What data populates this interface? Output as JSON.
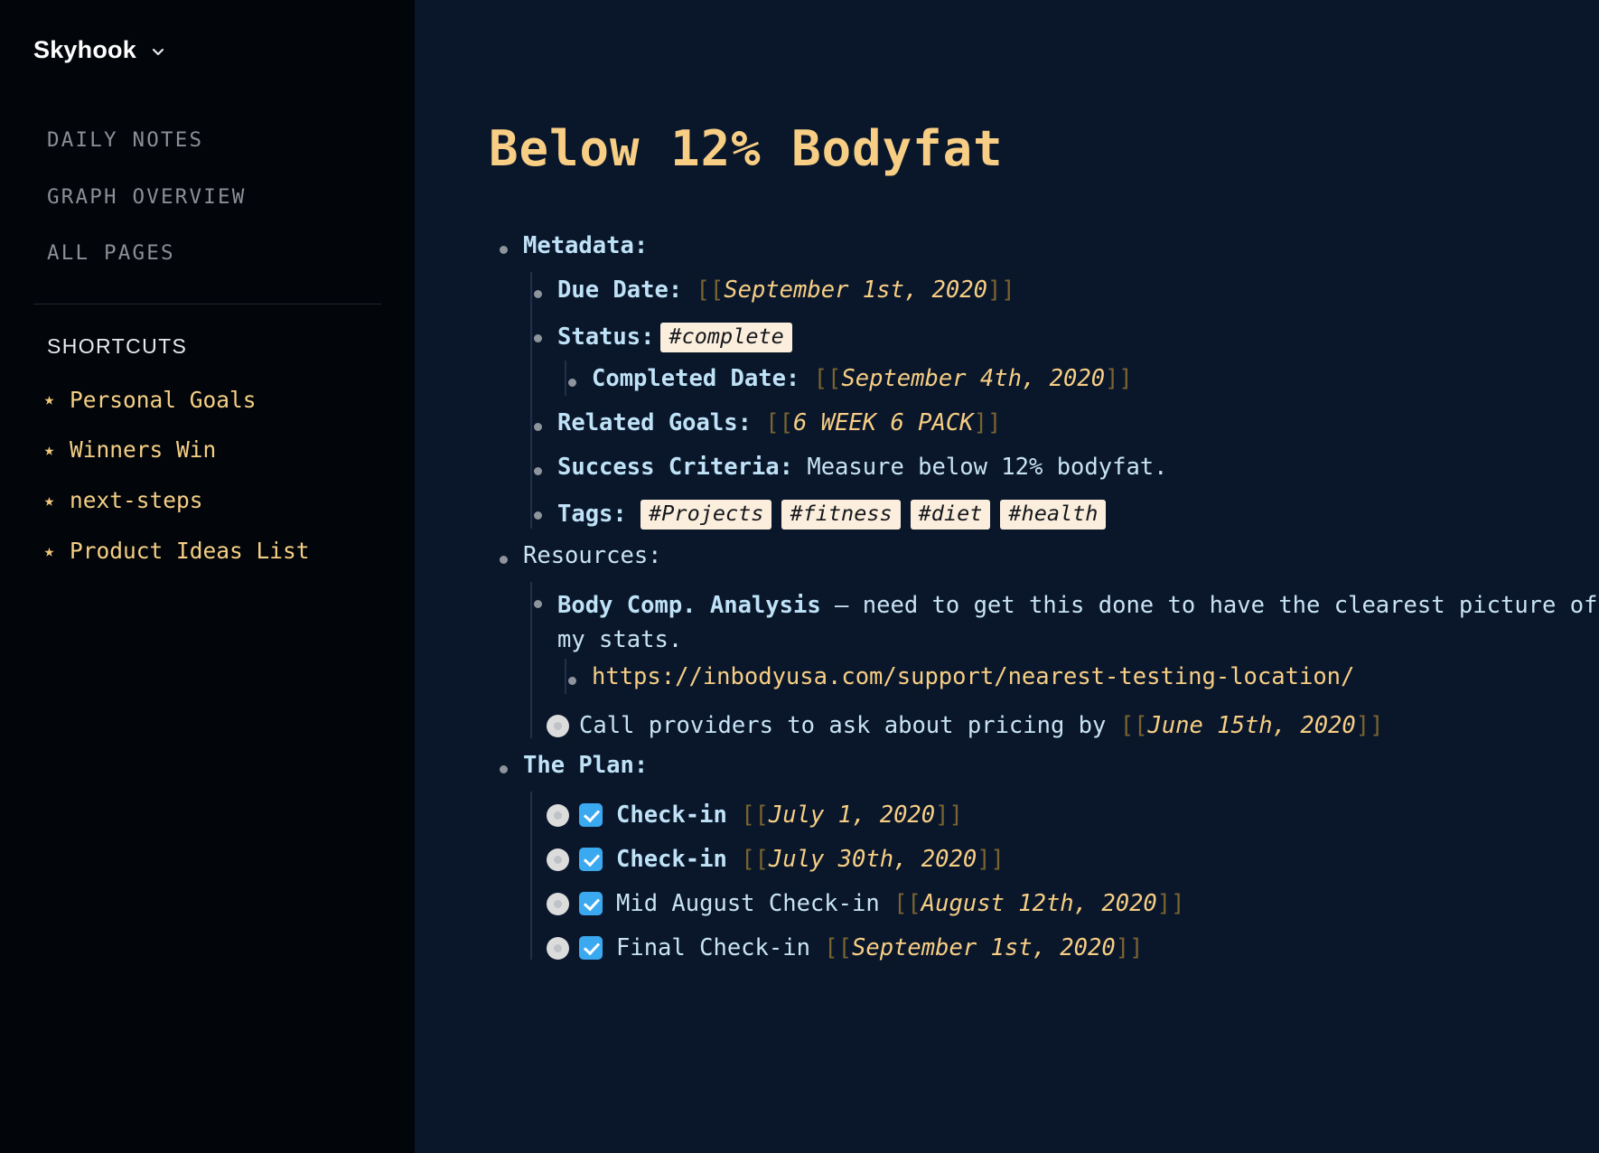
{
  "sidebar": {
    "brand": "Skyhook",
    "brand_chevron_icon": "chevron-down-icon",
    "nav": [
      {
        "label": "DAILY NOTES"
      },
      {
        "label": "GRAPH OVERVIEW"
      },
      {
        "label": "ALL PAGES"
      }
    ],
    "shortcuts_heading": "SHORTCUTS",
    "shortcut_star_icon": "star-icon",
    "shortcuts": [
      {
        "label": "Personal Goals"
      },
      {
        "label": "Winners Win"
      },
      {
        "label": "next-steps"
      },
      {
        "label": "Product Ideas List"
      }
    ]
  },
  "page": {
    "title": "Below 12% Bodyfat",
    "metadata_label": "Metadata:",
    "due_date_label": "Due Date:",
    "due_date_ref": "September 1st, 2020",
    "status_label": "Status:",
    "status_tag": "#complete",
    "completed_date_label": "Completed Date:",
    "completed_date_ref": "September 4th, 2020",
    "related_goals_label": "Related Goals:",
    "related_goals_ref": "6 WEEK 6 PACK",
    "success_criteria_label": "Success Criteria:",
    "success_criteria_value": " Measure below 12% bodyfat.",
    "tags_label": "Tags:",
    "tags": [
      "#Projects",
      "#fitness",
      "#diet",
      "#health"
    ],
    "resources_label": "Resources:",
    "resource_title": "Body Comp. Analysis",
    "resource_body": " — need to get this done to have the clearest picture of my stats.",
    "resource_url": "https://inbodyusa.com/support/nearest-testing-location/",
    "call_providers_text": "Call providers to ask about pricing by ",
    "call_providers_ref": "June 15th, 2020",
    "plan_label": "The Plan:",
    "plan_items": [
      {
        "text": "Check-in",
        "bold": true,
        "ref": "July 1, 2020",
        "checked": true
      },
      {
        "text": "Check-in",
        "bold": true,
        "ref": "July 30th, 2020",
        "checked": true
      },
      {
        "text": "Mid August Check-in",
        "bold": false,
        "ref": "August 12th, 2020",
        "checked": true
      },
      {
        "text": "Final Check-in",
        "bold": false,
        "ref": "September 1st, 2020",
        "checked": true
      }
    ],
    "bracket_open": "[[",
    "bracket_close": "]]"
  },
  "colors": {
    "sidebar_bg": "#02050a",
    "main_bg": "#0a172b",
    "accent_amber": "#f7ce84",
    "text_blue": "#c8e3f5",
    "tag_bg": "#fbeedd",
    "checkbox_blue": "#3aa9f0",
    "bracket": "#7a6330",
    "nav_grey": "#8c9096"
  }
}
